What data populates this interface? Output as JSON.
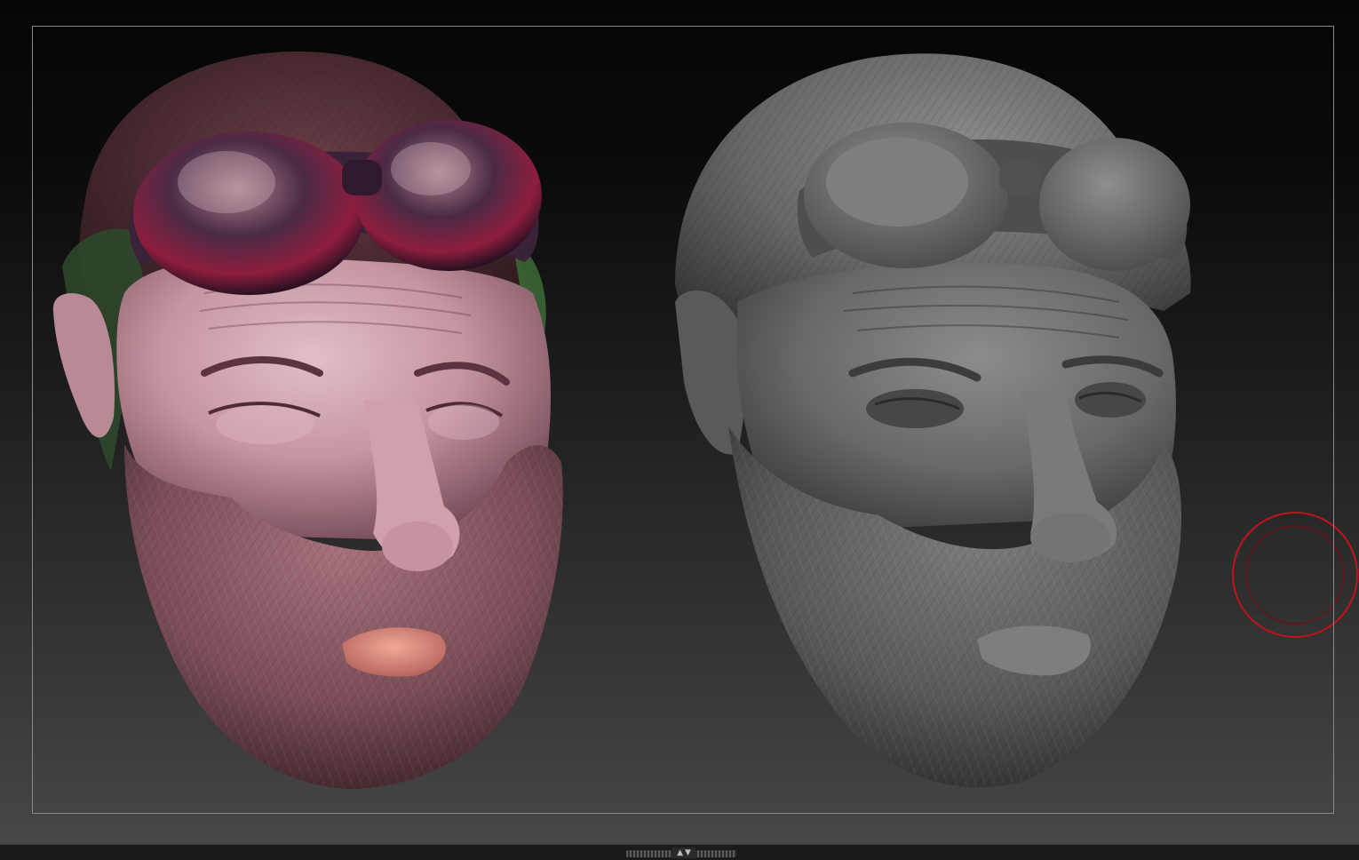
{
  "viewport": {
    "background_top": "#050505",
    "background_bottom": "#474747",
    "frame_color": "#8a8a8a"
  },
  "models": {
    "left": {
      "name": "polypaint-head",
      "skin": "#c99aa6",
      "beard": "#7a4f58",
      "hair": "#4a2b30",
      "goggles": "#3a2238",
      "lens_accent": "#9a2240"
    },
    "right": {
      "name": "clay-head",
      "clay": "#6e6e6e",
      "clay_dark": "#3e3e3e",
      "clay_light": "#9a9a9a"
    }
  },
  "cursor": {
    "color": "#c0141c",
    "icon": "brush-cursor-icon"
  },
  "bottom_bar": {
    "icon_up": "▲",
    "icon_down": "▼"
  }
}
